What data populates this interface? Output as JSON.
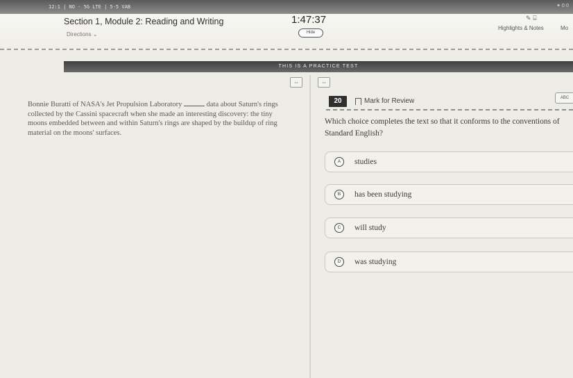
{
  "status_bar": {
    "left": "12:1 | NO · 5G LTE | 5·5 VAB",
    "right": "✦ 0·0"
  },
  "header": {
    "section_title": "Section 1, Module 2: Reading and Writing",
    "directions_label": "Directions",
    "timer": "1:47:37",
    "hide_label": "Hide",
    "highlights_label": "Highlights & Notes",
    "more_label": "Mo"
  },
  "banner": {
    "text": "THIS IS A PRACTICE TEST"
  },
  "page_controls": [
    "⇔",
    "⇔"
  ],
  "passage": {
    "before_blank": "Bonnie Buratti of NASA's Jet Propulsion Laboratory",
    "after_blank": "data about Saturn's rings collected by the Cassini spacecraft when she made an interesting discovery: the tiny moons embedded between and within Saturn's rings are shaped by the buildup of ring material on the moons' surfaces."
  },
  "question": {
    "number": "20",
    "mark_for_review": "Mark for Review",
    "abc_label": "ABC",
    "prompt": "Which choice completes the text so that it conforms to the conventions of Standard English?",
    "options": [
      {
        "letter": "A",
        "text": "studies"
      },
      {
        "letter": "B",
        "text": "has been studying"
      },
      {
        "letter": "C",
        "text": "will study"
      },
      {
        "letter": "D",
        "text": "was studying"
      }
    ]
  },
  "icons": {
    "pen": "pen-icon",
    "annotate": "annotate-icon",
    "bookmark": "bookmark-icon",
    "chevron": "chevron-down-icon"
  }
}
